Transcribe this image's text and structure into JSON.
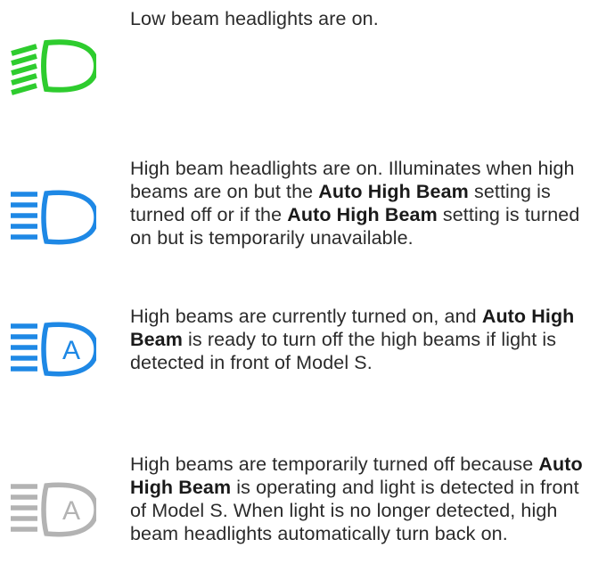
{
  "colors": {
    "low_beam": "#2ecc2e",
    "high_beam": "#1e88e5",
    "auto_unavailable": "#b3b3b3",
    "text": "#2b2b2b"
  },
  "entries": [
    {
      "icon": "low-beam-headlight-icon",
      "text": [
        "Low beam headlights are on."
      ]
    },
    {
      "icon": "high-beam-headlight-icon",
      "text": [
        "High beam headlights are on. Illuminates when high beams are on but the ",
        "Auto High Beam",
        " setting is turned off or if the ",
        "Auto High Beam",
        " setting is turned on but is temporarily unavailable."
      ]
    },
    {
      "icon": "auto-high-beam-active-icon",
      "text": [
        "High beams are currently turned on, and ",
        "Auto High Beam",
        " is ready to turn off the high beams if light is detected in front of Model S."
      ]
    },
    {
      "icon": "auto-high-beam-off-icon",
      "text": [
        "High beams are temporarily turned off because ",
        "Auto High Beam",
        " is operating and light is detected in front of Model S. When light is no longer detected, high beam headlights automatically turn back on."
      ]
    }
  ]
}
